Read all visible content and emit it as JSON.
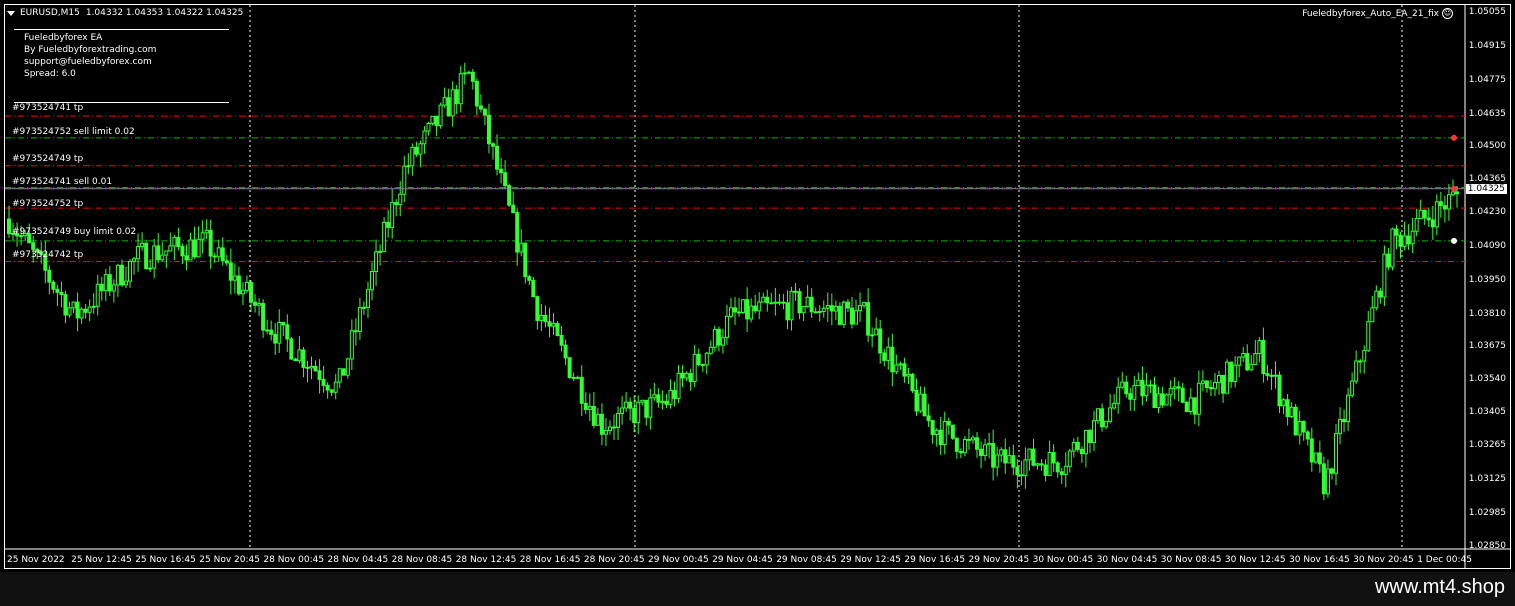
{
  "header": {
    "symbol_label": "EURUSD,M15",
    "ohlc": "1.04332 1.04353 1.04322 1.04325",
    "ea_name": "Fueledbyforex_Auto_EA_21_fix"
  },
  "info": {
    "line1": "Fueledbyforex EA",
    "line2": "By Fueledbyforextrading.com",
    "line3": "support@fueledbyforex.com",
    "line4": "Spread: 6.0"
  },
  "orders": [
    {
      "label": "#973524741 tp",
      "price": 1.04625,
      "color": "#ff0000"
    },
    {
      "label": "#973524752 sell limit 0.02",
      "price": 1.04535,
      "color": "#00c000"
    },
    {
      "label": "#973524749 tp",
      "price": 1.0442,
      "color": "#ff0000"
    },
    {
      "label": "#973524741 sell 0.01",
      "price": 1.0433,
      "color": "#00c000"
    },
    {
      "label": "#973524752 tp",
      "price": 1.04245,
      "color": "#ff0000"
    },
    {
      "label": "#973524749 buy limit 0.02",
      "price": 1.0411,
      "color": "#00c000"
    },
    {
      "label": "#973524742 tp",
      "price": 1.04025,
      "color": "#ff0000"
    }
  ],
  "axis": {
    "price_ticks": [
      "1.05055",
      "1.04915",
      "1.04775",
      "1.04635",
      "1.04500",
      "1.04365",
      "1.04230",
      "1.04090",
      "1.03950",
      "1.03810",
      "1.03675",
      "1.03540",
      "1.03405",
      "1.03265",
      "1.03125",
      "1.02985",
      "1.02850"
    ],
    "current_price": "1.04325",
    "time_ticks": [
      "25 Nov 2022",
      "25 Nov 12:45",
      "25 Nov 16:45",
      "25 Nov 20:45",
      "28 Nov 00:45",
      "28 Nov 04:45",
      "28 Nov 08:45",
      "28 Nov 12:45",
      "28 Nov 16:45",
      "28 Nov 20:45",
      "29 Nov 00:45",
      "29 Nov 04:45",
      "29 Nov 08:45",
      "29 Nov 12:45",
      "29 Nov 16:45",
      "29 Nov 20:45",
      "30 Nov 00:45",
      "30 Nov 04:45",
      "30 Nov 08:45",
      "30 Nov 12:45",
      "30 Nov 16:45",
      "30 Nov 20:45",
      "1 Dec 00:45"
    ]
  },
  "colors": {
    "candle": "#33ff33",
    "background": "#000000",
    "grid": "#ffffff",
    "sell_line": "#ff0000",
    "buy_line": "#00c000"
  },
  "watermark": "www.mt4.shop",
  "chart_data": {
    "type": "line",
    "title": "EURUSD,M15",
    "xlabel": "",
    "ylabel": "",
    "ylim": [
      1.0285,
      1.05055
    ],
    "x": [
      "25 Nov 2022",
      "25 Nov 12:45",
      "25 Nov 16:45",
      "25 Nov 20:45",
      "28 Nov 00:45",
      "28 Nov 04:45",
      "28 Nov 08:45",
      "28 Nov 12:45",
      "28 Nov 16:45",
      "28 Nov 20:45",
      "29 Nov 00:45",
      "29 Nov 04:45",
      "29 Nov 08:45",
      "29 Nov 12:45",
      "29 Nov 16:45",
      "29 Nov 20:45",
      "30 Nov 00:45",
      "30 Nov 04:45",
      "30 Nov 08:45",
      "30 Nov 12:45",
      "30 Nov 16:45",
      "30 Nov 20:45",
      "1 Dec 00:45"
    ],
    "series": [
      {
        "values": [
          1.042,
          1.038,
          1.0405,
          1.041,
          1.0375,
          1.035,
          1.044,
          1.048,
          1.0385,
          1.0335,
          1.0345,
          1.038,
          1.0385,
          1.038,
          1.0335,
          1.032,
          1.032,
          1.035,
          1.0345,
          1.0365,
          1.031,
          1.041,
          1.043
        ]
      }
    ]
  }
}
